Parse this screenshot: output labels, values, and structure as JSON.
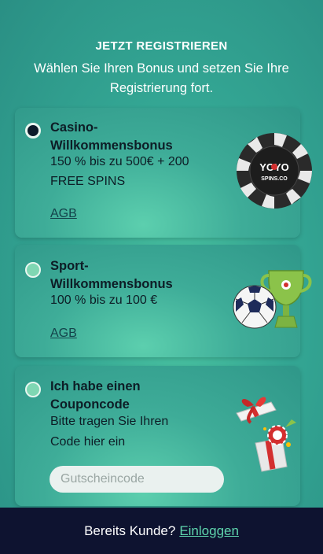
{
  "header": {
    "title": "JETZT REGISTRIEREN",
    "subtitle": "Wählen Sie Ihren Bonus und setzen Sie Ihre Registrierung fort."
  },
  "options": [
    {
      "title_line1": "Casino-",
      "title_line2": "Willkommensbonus",
      "desc_line1": "150 % bis zu 500€ + 200",
      "desc_line2": "FREE SPINS",
      "terms_link": "AGB",
      "selected": true,
      "icon": "casino-chip-icon",
      "chip_text_top": "YOYO",
      "chip_text_bottom": "SPINS.CO"
    },
    {
      "title_line1": "Sport-",
      "title_line2": "Willkommensbonus",
      "desc_line1": "100 % bis zu 100 €",
      "terms_link": "AGB",
      "selected": false,
      "icon": "soccer-trophy-icon"
    },
    {
      "title_line1": "Ich habe einen",
      "title_line2": "Couponcode",
      "desc_line1": "Bitte tragen Sie Ihren",
      "desc_line2": "Code hier ein",
      "selected": false,
      "icon": "gift-box-icon",
      "coupon_placeholder": "Gutscheincode"
    }
  ],
  "footer": {
    "text": "Bereits Kunde?",
    "login_link": "Einloggen"
  }
}
